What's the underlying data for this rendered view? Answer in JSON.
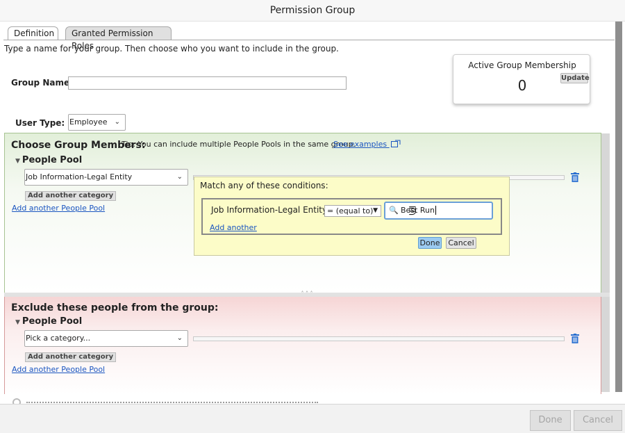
{
  "window": {
    "title": "Permission Group"
  },
  "tabs": [
    {
      "label": "Definition",
      "active": true
    },
    {
      "label": "Granted Permission Roles",
      "active": false
    }
  ],
  "intro_text": "Type a name for your group. Then choose who you want to include in the group.",
  "active_group_membership": {
    "title": "Active Group Membership",
    "count": "0",
    "update_label": "Update"
  },
  "group_name": {
    "label": "Group Name:",
    "value": ""
  },
  "user_type": {
    "label": "User Type:",
    "selected": "Employee"
  },
  "choose_members": {
    "title": "Choose Group Members:",
    "tip": "Tip: You can include multiple People Pools in the same group.",
    "see_examples": "See examples",
    "pool_title": "People Pool",
    "category_selected": "Job Information-Legal Entity",
    "add_category_label": "Add another category",
    "add_pool_label": "Add another People Pool"
  },
  "condition_popup": {
    "title": "Match any of these conditions:",
    "field_label": "Job Information-Legal Entity is",
    "operator": "= (equal to)",
    "search_value": "Best Run",
    "add_another": "Add another",
    "done_label": "Done",
    "cancel_label": "Cancel"
  },
  "exclude": {
    "title": "Exclude these people from the group:",
    "pool_title": "People Pool",
    "category_placeholder": "Pick a category...",
    "add_category_label": "Add another category",
    "add_pool_label": "Add another People Pool"
  },
  "footer": {
    "done_label": "Done",
    "cancel_label": "Cancel"
  },
  "colors": {
    "include_bg": "#e2efd9",
    "exclude_bg": "#f6d5d5",
    "link": "#1a55c0",
    "primary_button": "#9ccbf1"
  }
}
